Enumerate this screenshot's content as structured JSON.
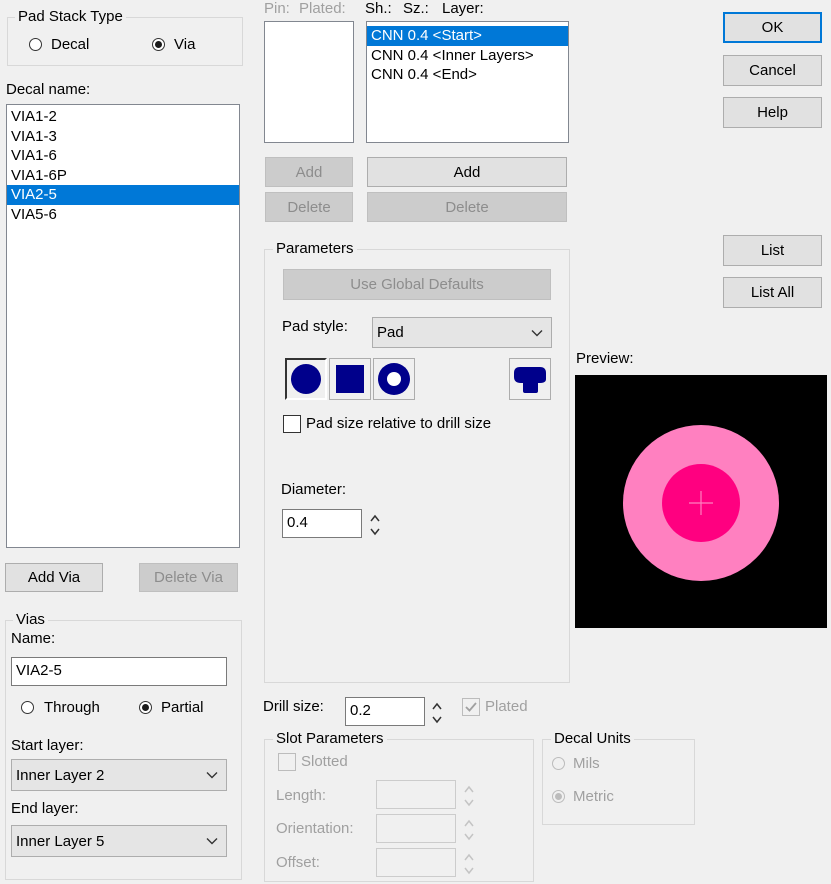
{
  "pad_stack_type": {
    "title": "Pad Stack Type",
    "options": [
      {
        "label": "Decal",
        "selected": false
      },
      {
        "label": "Via",
        "selected": true
      }
    ]
  },
  "decal_name": {
    "label": "Decal name:",
    "items": [
      "VIA1-2",
      "VIA1-3",
      "VIA1-6",
      "VIA1-6P",
      "VIA2-5",
      "VIA5-6"
    ],
    "selected_index": 4
  },
  "via_buttons": {
    "add": "Add Via",
    "delete": "Delete Via"
  },
  "vias": {
    "title": "Vias",
    "name_label": "Name:",
    "name_value": "VIA2-5",
    "options": [
      {
        "label": "Through",
        "selected": false
      },
      {
        "label": "Partial",
        "selected": true
      }
    ],
    "start_layer_label": "Start layer:",
    "start_layer_value": "Inner Layer 2",
    "end_layer_label": "End layer:",
    "end_layer_value": "Inner Layer 5"
  },
  "pin_list": {
    "header_pin": "Pin:",
    "header_plated": "Plated:",
    "add": "Add",
    "delete": "Delete"
  },
  "layer_list": {
    "header_sh": "Sh.:",
    "header_sz": "Sz.:",
    "header_layer": "Layer:",
    "items": [
      "CNN 0.4 <Start>",
      "CNN 0.4 <Inner Layers>",
      "CNN 0.4 <End>"
    ],
    "selected_index": 0,
    "add": "Add",
    "delete": "Delete"
  },
  "parameters": {
    "title": "Parameters",
    "use_global_defaults": "Use Global Defaults",
    "pad_style_label": "Pad style:",
    "pad_style_value": "Pad",
    "shapes": [
      "round-pad-icon",
      "square-pad-icon",
      "annular-pad-icon",
      "odd-pad-icon"
    ],
    "relative_label": "Pad size relative to drill size",
    "relative_checked": false,
    "diameter_label": "Diameter:",
    "diameter_value": "0.4"
  },
  "drill": {
    "label": "Drill size:",
    "value": "0.2",
    "plated_label": "Plated",
    "plated_checked": true
  },
  "slot": {
    "title": "Slot Parameters",
    "slotted_label": "Slotted",
    "length_label": "Length:",
    "orientation_label": "Orientation:",
    "offset_label": "Offset:"
  },
  "decal_units": {
    "title": "Decal Units",
    "options": [
      {
        "label": "Mils",
        "selected": false
      },
      {
        "label": "Metric",
        "selected": true
      }
    ]
  },
  "dialog_buttons": {
    "ok": "OK",
    "cancel": "Cancel",
    "help": "Help",
    "list": "List",
    "list_all": "List All"
  },
  "preview": {
    "label": "Preview:",
    "background": "#000000",
    "pad_color": "#ff80c0",
    "drill_color": "#ff0080",
    "cross_color": "#ff80c0"
  },
  "colors": {
    "accent": "#0078d7",
    "shape_fill": "#00008b"
  }
}
